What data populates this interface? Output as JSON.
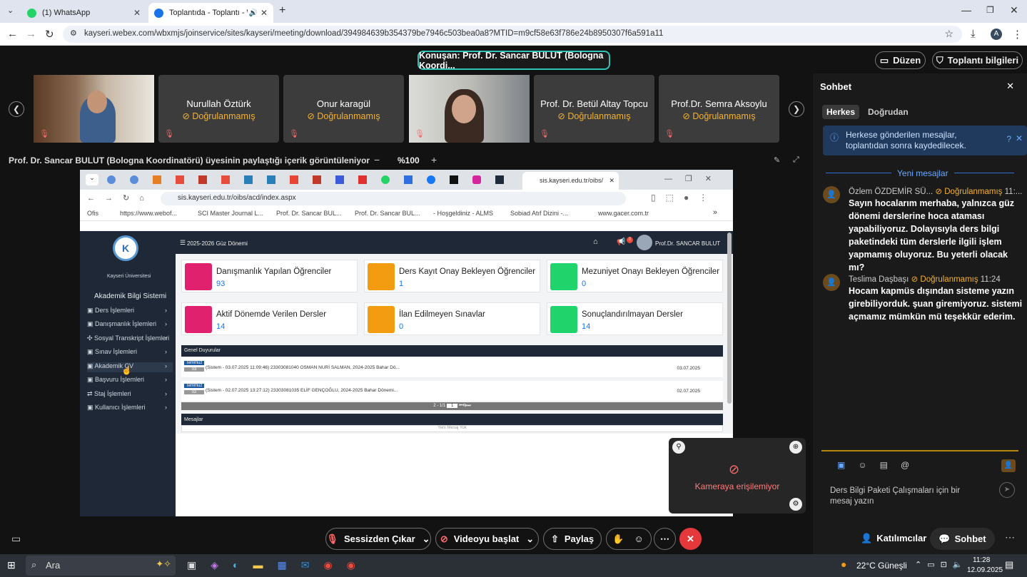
{
  "browser": {
    "tabs": [
      {
        "label": "(1) WhatsApp",
        "active": false
      },
      {
        "label": "Toplantıda - Toplantı - Webex",
        "active": true
      }
    ],
    "new_tab": "+",
    "url": "kayseri.webex.com/wbxmjs/joinservice/sites/kayseri/meeting/download/394984639b354379be7946c503bea0a8?MTID=m9cf58e63f786e24b8950307f6a591a11",
    "profile_initial": "A"
  },
  "meeting": {
    "speaker": "Konuşan: Prof. Dr. Sancar BULUT (Bologna Koordi...",
    "layout_label": "Düzen",
    "info_label": "Toplantı bilgileri",
    "participants": [
      {
        "name": "",
        "video": true
      },
      {
        "name": "Nurullah Öztürk",
        "status": "Doğrulanmamış"
      },
      {
        "name": "Onur karagül",
        "status": "Doğrulanmamış"
      },
      {
        "name": "",
        "video": true
      },
      {
        "name": "Prof. Dr. Betül Altay Topcu",
        "status": "Doğrulanmamış"
      },
      {
        "name": "Prof.Dr. Semra Aksoylu",
        "status": "Doğrulanmamış"
      }
    ],
    "share_caption": "Prof. Dr. Sancar BULUT (Bologna Koordinatörü) üyesinin paylaştığı içerik görüntüleniyor",
    "zoom": "%100",
    "zoom_minus": "−",
    "zoom_plus": "+"
  },
  "shared": {
    "tab_title": "sis.kayseri.edu.tr/oibs/",
    "url": "sis.kayseri.edu.tr/oibs/acd/index.aspx",
    "bookmarks": [
      "Ofis",
      "https://www.webof...",
      "SCI Master Journal L...",
      "Prof. Dr. Sancar BUL...",
      "Prof. Dr. Sancar BUL...",
      "- Hoşgeldiniz - ALMS",
      "Sobiad Atıf Dizini -...",
      "www.gacer.com.tr"
    ],
    "university": "Kayseri Üniversitesi",
    "system": "Akademik Bilgi Sistemi",
    "term": "2025-2026 Güz Dönemi",
    "notif_count": "0",
    "user": "Prof.Dr. SANCAR BULUT",
    "menu": [
      "Ders İşlemleri",
      "Danışmanlık İşlemleri",
      "Sosyal Transkript İşlemleri",
      "Sınav İşlemleri",
      "Akademik CV",
      "Başvuru İşlemleri",
      "Staj İşlemleri",
      "Kullanıcı İşlemleri"
    ],
    "cards": [
      {
        "title": "Danışmanlık Yapılan Öğrenciler",
        "value": "93",
        "color": "#e0226e"
      },
      {
        "title": "Ders Kayıt Onay Bekleyen Öğrenciler",
        "value": "1",
        "color": "#f39c12"
      },
      {
        "title": "Mezuniyet Onayı Bekleyen Öğrenciler",
        "value": "0",
        "color": "#20d36a"
      },
      {
        "title": "Aktif Dönemde Verilen Dersler",
        "value": "14",
        "color": "#e0226e"
      },
      {
        "title": "İlan Edilmeyen Sınavlar",
        "value": "0",
        "color": "#f39c12"
      },
      {
        "title": "Sonuçlandırılmayan Dersler",
        "value": "14",
        "color": "#20d36a"
      }
    ],
    "announcements_title": "Genel Duyurular",
    "announcements": [
      {
        "month": "Temmuz",
        "day": "03",
        "text": "(Sistem - 03.07.2025 11:09:46) 23303081040 OSMAN NURİ SALMAN, 2024-2025 Bahar Dö...",
        "date": "03.07.2025"
      },
      {
        "month": "Temmuz",
        "day": "02",
        "text": "(Sistem - 02.07.2025 13:27:12) 23303081035 ELİF GENÇOĞLU, 2024-2025 Bahar Dönemi...",
        "date": "02.07.2025"
      }
    ],
    "pager": "2 - 1/1",
    "page_select": "1",
    "messages_title": "Mesajlar",
    "no_message": "Yeni Mesaj Yok"
  },
  "self_view": {
    "camera_status": "Kameraya erişilemiyor"
  },
  "chat": {
    "title": "Sohbet",
    "tabs": [
      "Herkes",
      "Doğrudan"
    ],
    "notice": "Herkese gönderilen mesajlar, toplantıdan sonra kaydedilecek.",
    "new_label": "Yeni mesajlar",
    "messages": [
      {
        "sender": "Özlem ÖZDEMİR SÜ...",
        "status": "Doğrulanmamış",
        "time": "11:...",
        "text": "Sayın hocalarım merhaba, yalnızca güz dönemi derslerine hoca ataması yapabiliyoruz. Dolayısıyla ders bilgi paketindeki tüm derslerle ilgili işlem yapmamış oluyoruz. Bu yeterli olacak mı?"
      },
      {
        "sender": "Teslima Daşbaşı",
        "status": "Doğrulanmamış",
        "time": "11:24",
        "text": "Hocam kapmüs dışından sisteme yazın girebiliyorduk. şuan giremiyoruz. sistemi açmamız mümkün mü teşekkür ederim."
      }
    ],
    "input_placeholder": "Ders Bilgi Paketi Çalışmaları için bir mesaj yazın"
  },
  "controls": {
    "unmute": "Sessizden Çıkar",
    "video": "Videoyu başlat",
    "share": "Paylaş",
    "participants": "Katılımcılar",
    "chat": "Sohbet"
  },
  "taskbar": {
    "search": "Ara",
    "weather": "22°C  Güneşli",
    "time": "11:28",
    "date": "12.09.2025"
  }
}
